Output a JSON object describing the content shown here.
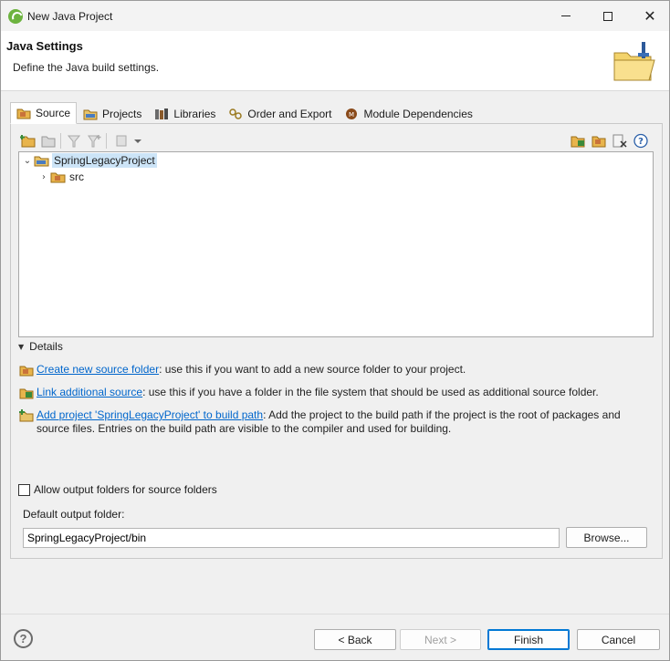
{
  "window": {
    "title": "New Java Project",
    "close_glyph": "✕"
  },
  "banner": {
    "title": "Java Settings",
    "description": "Define the Java build settings."
  },
  "tabs": [
    {
      "label": "Source",
      "icon": "source-folder-icon",
      "active": true
    },
    {
      "label": "Projects",
      "icon": "projects-icon",
      "active": false
    },
    {
      "label": "Libraries",
      "icon": "libraries-icon",
      "active": false
    },
    {
      "label": "Order and Export",
      "icon": "order-export-icon",
      "active": false
    },
    {
      "label": "Module Dependencies",
      "icon": "module-icon",
      "active": false
    }
  ],
  "tree": {
    "project": {
      "label": "SpringLegacyProject",
      "expanded": true,
      "selected": true
    },
    "children": [
      {
        "label": "src",
        "expanded": false
      }
    ]
  },
  "details": {
    "heading": "Details",
    "items": [
      {
        "link": "Create new source folder",
        "text": ": use this if you want to add a new source folder to your project."
      },
      {
        "link": "Link additional source",
        "text": ": use this if you have a folder in the file system that should be used as additional source folder."
      },
      {
        "link": "Add project 'SpringLegacyProject' to build path",
        "text": ": Add the project to the build path if the project is the root of packages and source files. Entries on the build path are visible to the compiler and used for building."
      }
    ]
  },
  "output": {
    "allow_label": "Allow output folders for source folders",
    "allow_checked": false,
    "default_label": "Default output folder:",
    "default_value": "SpringLegacyProject/bin",
    "browse_label": "Browse..."
  },
  "footer": {
    "help_glyph": "?",
    "back_label": "< Back",
    "next_label": "Next >",
    "finish_label": "Finish",
    "cancel_label": "Cancel"
  },
  "colors": {
    "link": "#0066cc",
    "selection": "#cce4f7",
    "default_button": "#0078d4"
  }
}
